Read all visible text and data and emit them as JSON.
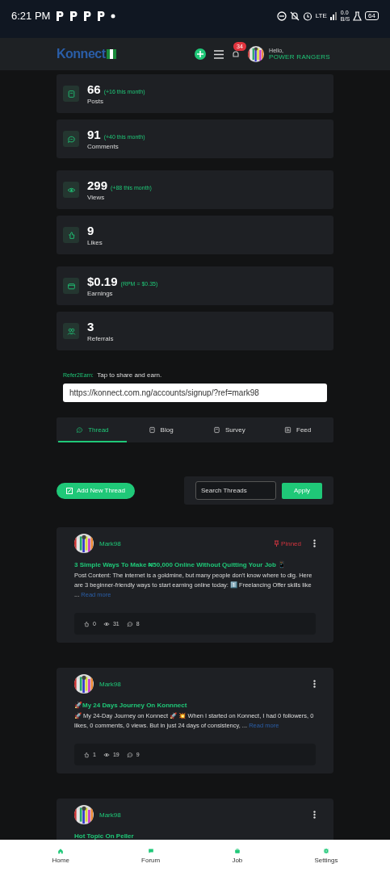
{
  "status_bar": {
    "time": "6:21 PM",
    "network": "LTE",
    "speed": "0.0",
    "speed_unit": "B/S",
    "battery": "64"
  },
  "header": {
    "logo": "Konnect",
    "notifications": "34",
    "greeting": "Hello,",
    "user": "POWER RANGERS"
  },
  "stats": [
    {
      "value": "66",
      "note": "(+16 this month)",
      "label": "Posts"
    },
    {
      "value": "91",
      "note": "(+40 this month)",
      "label": "Comments"
    },
    {
      "value": "299",
      "note": "(+88 this month)",
      "label": "Views"
    },
    {
      "value": "9",
      "label": "Likes"
    },
    {
      "value": "$0.19",
      "note": "(RPM = $0.35)",
      "label": "Earnings"
    },
    {
      "value": "3",
      "label": "Referrals"
    }
  ],
  "referral": {
    "tag": "Refer2Earn:",
    "hint": "Tap to share and earn.",
    "link": "https://konnect.com.ng/accounts/signup/?ref=mark98"
  },
  "tabs": [
    {
      "label": "Thread",
      "selected": true
    },
    {
      "label": "Blog",
      "selected": false
    },
    {
      "label": "Survey",
      "selected": false
    },
    {
      "label": "Feed",
      "selected": false
    }
  ],
  "toolbar": {
    "add_button": "Add New Thread",
    "search_placeholder": "Search Threads",
    "apply_button": "Apply"
  },
  "posts": [
    {
      "author": "Mark98",
      "pinned": true,
      "pin_label": "Pinned",
      "title": "3 Simple Ways To Make ₦50,000 Online Without Quitting Your Job 📱",
      "body": "Post Content: The internet is a goldmine, but many people don't know where to dig. Here are 3 beginner-friendly ways to start earning online today: 1️⃣ Freelancing Offer skills like ...",
      "read_more": "Read more",
      "likes": "0",
      "views": "31",
      "comments": "8"
    },
    {
      "author": "Mark98",
      "pinned": false,
      "title": "🚀My 24 Days Journey On Konnnect",
      "body": "🚀 My 24-Day Journey on Konnect 🚀 💥 When I started on Konnect, I had 0 followers, 0 likes, 0 comments, 0 views. But in just 24 days of consistency, ...",
      "read_more": "Read more",
      "likes": "1",
      "views": "19",
      "comments": "9"
    },
    {
      "author": "Mark98",
      "pinned": false,
      "title": "Hot Topic On Peller"
    }
  ],
  "bottom_nav": [
    {
      "label": "Home"
    },
    {
      "label": "Forum"
    },
    {
      "label": "Job"
    },
    {
      "label": "Settings"
    }
  ]
}
